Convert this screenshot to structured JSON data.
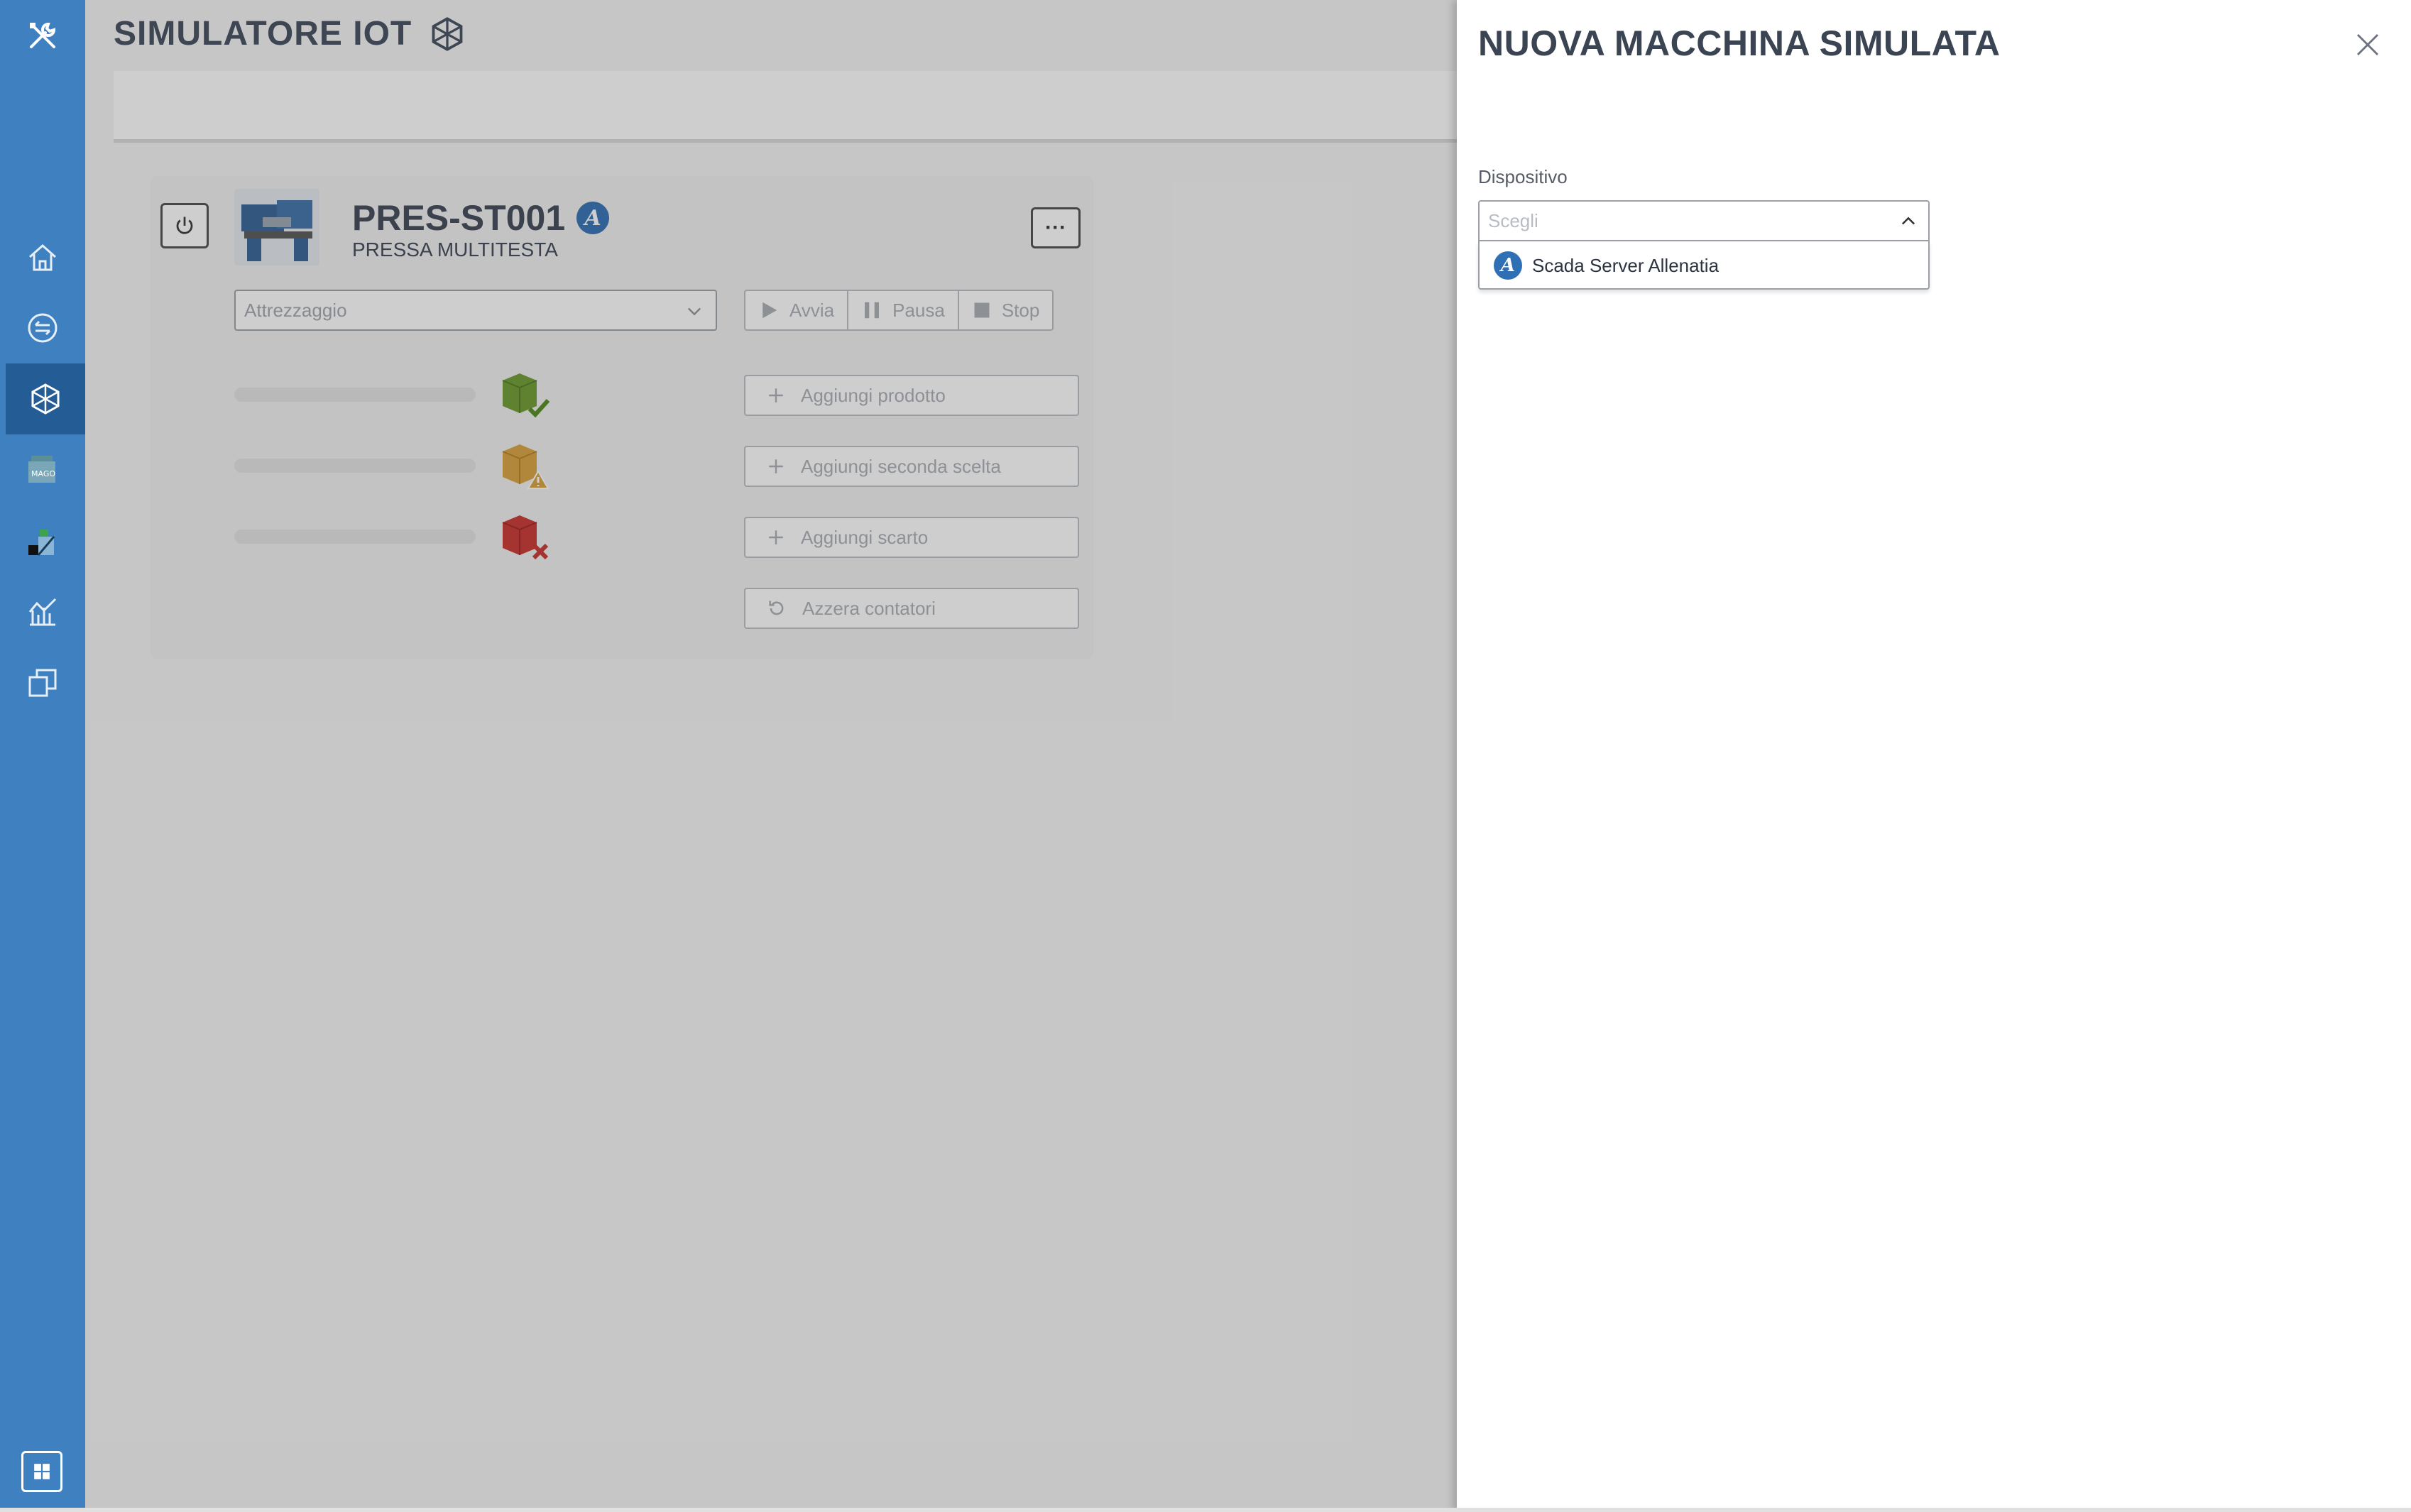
{
  "app": {
    "page_title": "SIMULATORE IOT"
  },
  "machine": {
    "code": "PRES-ST001",
    "description": "PRESSA MULTITESTA",
    "badge_letter": "A",
    "more_label": "···",
    "tooling_placeholder": "Attrezzaggio",
    "controls": {
      "start": "Avvia",
      "pause": "Pausa",
      "stop": "Stop"
    },
    "actions": {
      "add_product": "Aggiungi prodotto",
      "add_second_choice": "Aggiungi seconda scelta",
      "add_scrap": "Aggiungi scarto",
      "reset_counters": "Azzera contatori"
    }
  },
  "panel": {
    "title": "NUOVA MACCHINA SIMULATA",
    "field_label": "Dispositivo",
    "select_placeholder": "Scegli",
    "options": [
      {
        "badge_letter": "A",
        "label": "Scada Server Allenatia"
      }
    ]
  },
  "sidebar": {
    "items": [
      {
        "icon": "tools-icon"
      },
      {
        "icon": "home-icon"
      },
      {
        "icon": "exchange-icon"
      },
      {
        "icon": "iot-cube-icon",
        "active": true
      },
      {
        "icon": "mago-icon"
      },
      {
        "icon": "dashboard-app-icon"
      },
      {
        "icon": "analytics-icon"
      },
      {
        "icon": "copy-icon"
      },
      {
        "icon": "windows-icon"
      }
    ]
  },
  "colors": {
    "sidebar": "#3f80c0",
    "sidebar_active": "#245c96",
    "badge": "#2f6fb3",
    "cube_ok": "#6a9a2c",
    "cube_warn": "#d9a23b",
    "cube_scrap": "#c9302c"
  }
}
